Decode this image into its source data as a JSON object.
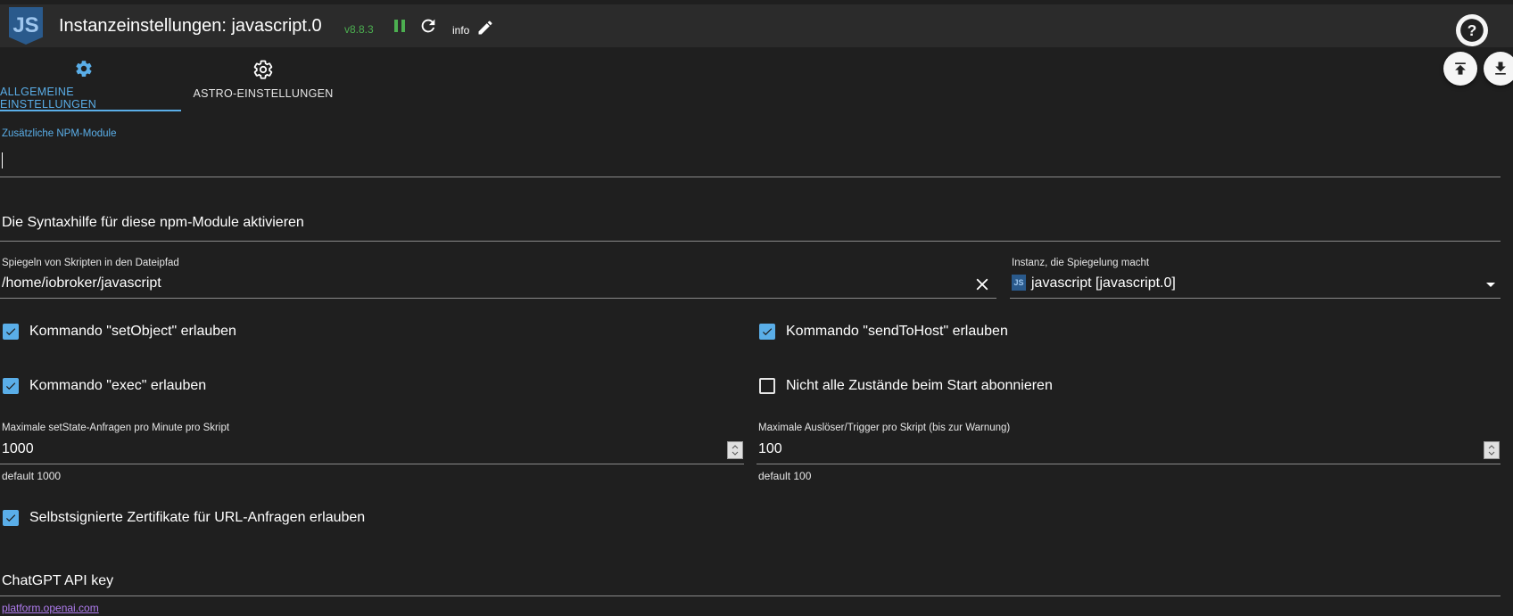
{
  "header": {
    "logo_text": "JS",
    "title": "Instanzeinstellungen: javascript.0",
    "version": "v8.8.3",
    "info_label": "info"
  },
  "icons": {
    "pause": "pause-icon",
    "reload": "reload-icon",
    "edit": "pencil-icon",
    "help": "help-icon",
    "upload": "upload-icon",
    "download": "download-icon"
  },
  "tabs": [
    {
      "label": "ALLGEMEINE EINSTELLUNGEN",
      "icon": "gear-icon",
      "active": true
    },
    {
      "label": "ASTRO-EINSTELLUNGEN",
      "icon": "gear-outline-icon",
      "active": false
    }
  ],
  "form": {
    "npm_modules": {
      "label": "Zusätzliche NPM-Module",
      "value": ""
    },
    "syntax_help": {
      "label": "Die Syntaxhilfe für diese npm-Module aktivieren"
    },
    "mirror_path": {
      "label": "Spiegeln von Skripten in den Dateipfad",
      "value": "/home/iobroker/javascript"
    },
    "mirror_instance": {
      "label": "Instanz, die Spiegelung macht",
      "icon_text": "JS",
      "value": "javascript [javascript.0]"
    },
    "checkboxes": {
      "setObject": {
        "label": "Kommando \"setObject\" erlauben",
        "checked": true
      },
      "sendToHost": {
        "label": "Kommando \"sendToHost\" erlauben",
        "checked": true
      },
      "exec": {
        "label": "Kommando \"exec\" erlauben",
        "checked": true
      },
      "no_subscribe": {
        "label": "Nicht alle Zustände beim Start abonnieren",
        "checked": false
      },
      "self_signed": {
        "label": "Selbstsignierte Zertifikate für URL-Anfragen erlauben",
        "checked": true
      }
    },
    "max_setstate": {
      "label": "Maximale setState-Anfragen pro Minute pro Skript",
      "value": "1000",
      "helper": "default 1000"
    },
    "max_triggers": {
      "label": "Maximale Auslöser/Trigger pro Skript (bis zur Warnung)",
      "value": "100",
      "helper": "default 100"
    },
    "chatgpt": {
      "label": "ChatGPT API key",
      "link": "platform.openai.com"
    }
  },
  "colors": {
    "accent": "#5aaee8",
    "version": "#4caf50",
    "background": "#1f1f1f",
    "topbar": "#2b2b2b",
    "link": "#b07cf0"
  }
}
